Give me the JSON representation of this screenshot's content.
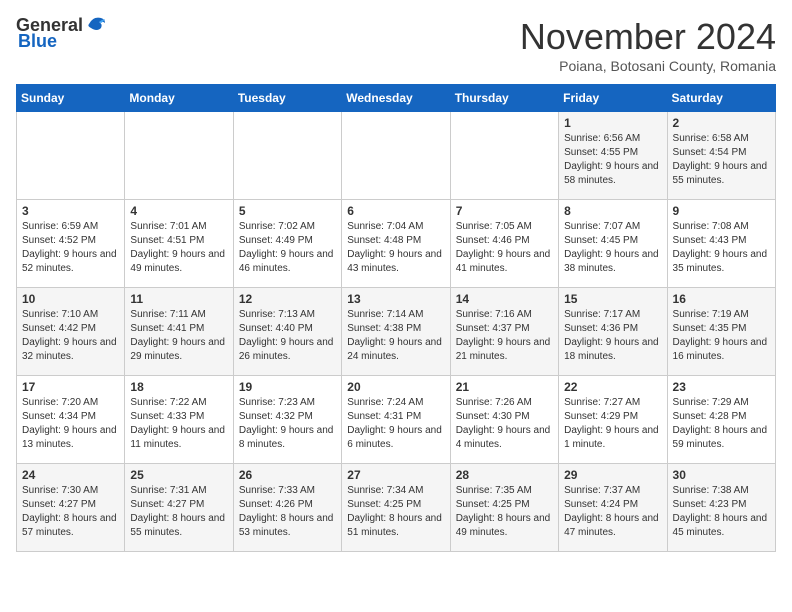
{
  "header": {
    "logo_general": "General",
    "logo_blue": "Blue",
    "month_title": "November 2024",
    "location": "Poiana, Botosani County, Romania"
  },
  "days_of_week": [
    "Sunday",
    "Monday",
    "Tuesday",
    "Wednesday",
    "Thursday",
    "Friday",
    "Saturday"
  ],
  "weeks": [
    [
      {
        "day": "",
        "info": ""
      },
      {
        "day": "",
        "info": ""
      },
      {
        "day": "",
        "info": ""
      },
      {
        "day": "",
        "info": ""
      },
      {
        "day": "",
        "info": ""
      },
      {
        "day": "1",
        "info": "Sunrise: 6:56 AM\nSunset: 4:55 PM\nDaylight: 9 hours and 58 minutes."
      },
      {
        "day": "2",
        "info": "Sunrise: 6:58 AM\nSunset: 4:54 PM\nDaylight: 9 hours and 55 minutes."
      }
    ],
    [
      {
        "day": "3",
        "info": "Sunrise: 6:59 AM\nSunset: 4:52 PM\nDaylight: 9 hours and 52 minutes."
      },
      {
        "day": "4",
        "info": "Sunrise: 7:01 AM\nSunset: 4:51 PM\nDaylight: 9 hours and 49 minutes."
      },
      {
        "day": "5",
        "info": "Sunrise: 7:02 AM\nSunset: 4:49 PM\nDaylight: 9 hours and 46 minutes."
      },
      {
        "day": "6",
        "info": "Sunrise: 7:04 AM\nSunset: 4:48 PM\nDaylight: 9 hours and 43 minutes."
      },
      {
        "day": "7",
        "info": "Sunrise: 7:05 AM\nSunset: 4:46 PM\nDaylight: 9 hours and 41 minutes."
      },
      {
        "day": "8",
        "info": "Sunrise: 7:07 AM\nSunset: 4:45 PM\nDaylight: 9 hours and 38 minutes."
      },
      {
        "day": "9",
        "info": "Sunrise: 7:08 AM\nSunset: 4:43 PM\nDaylight: 9 hours and 35 minutes."
      }
    ],
    [
      {
        "day": "10",
        "info": "Sunrise: 7:10 AM\nSunset: 4:42 PM\nDaylight: 9 hours and 32 minutes."
      },
      {
        "day": "11",
        "info": "Sunrise: 7:11 AM\nSunset: 4:41 PM\nDaylight: 9 hours and 29 minutes."
      },
      {
        "day": "12",
        "info": "Sunrise: 7:13 AM\nSunset: 4:40 PM\nDaylight: 9 hours and 26 minutes."
      },
      {
        "day": "13",
        "info": "Sunrise: 7:14 AM\nSunset: 4:38 PM\nDaylight: 9 hours and 24 minutes."
      },
      {
        "day": "14",
        "info": "Sunrise: 7:16 AM\nSunset: 4:37 PM\nDaylight: 9 hours and 21 minutes."
      },
      {
        "day": "15",
        "info": "Sunrise: 7:17 AM\nSunset: 4:36 PM\nDaylight: 9 hours and 18 minutes."
      },
      {
        "day": "16",
        "info": "Sunrise: 7:19 AM\nSunset: 4:35 PM\nDaylight: 9 hours and 16 minutes."
      }
    ],
    [
      {
        "day": "17",
        "info": "Sunrise: 7:20 AM\nSunset: 4:34 PM\nDaylight: 9 hours and 13 minutes."
      },
      {
        "day": "18",
        "info": "Sunrise: 7:22 AM\nSunset: 4:33 PM\nDaylight: 9 hours and 11 minutes."
      },
      {
        "day": "19",
        "info": "Sunrise: 7:23 AM\nSunset: 4:32 PM\nDaylight: 9 hours and 8 minutes."
      },
      {
        "day": "20",
        "info": "Sunrise: 7:24 AM\nSunset: 4:31 PM\nDaylight: 9 hours and 6 minutes."
      },
      {
        "day": "21",
        "info": "Sunrise: 7:26 AM\nSunset: 4:30 PM\nDaylight: 9 hours and 4 minutes."
      },
      {
        "day": "22",
        "info": "Sunrise: 7:27 AM\nSunset: 4:29 PM\nDaylight: 9 hours and 1 minute."
      },
      {
        "day": "23",
        "info": "Sunrise: 7:29 AM\nSunset: 4:28 PM\nDaylight: 8 hours and 59 minutes."
      }
    ],
    [
      {
        "day": "24",
        "info": "Sunrise: 7:30 AM\nSunset: 4:27 PM\nDaylight: 8 hours and 57 minutes."
      },
      {
        "day": "25",
        "info": "Sunrise: 7:31 AM\nSunset: 4:27 PM\nDaylight: 8 hours and 55 minutes."
      },
      {
        "day": "26",
        "info": "Sunrise: 7:33 AM\nSunset: 4:26 PM\nDaylight: 8 hours and 53 minutes."
      },
      {
        "day": "27",
        "info": "Sunrise: 7:34 AM\nSunset: 4:25 PM\nDaylight: 8 hours and 51 minutes."
      },
      {
        "day": "28",
        "info": "Sunrise: 7:35 AM\nSunset: 4:25 PM\nDaylight: 8 hours and 49 minutes."
      },
      {
        "day": "29",
        "info": "Sunrise: 7:37 AM\nSunset: 4:24 PM\nDaylight: 8 hours and 47 minutes."
      },
      {
        "day": "30",
        "info": "Sunrise: 7:38 AM\nSunset: 4:23 PM\nDaylight: 8 hours and 45 minutes."
      }
    ]
  ]
}
